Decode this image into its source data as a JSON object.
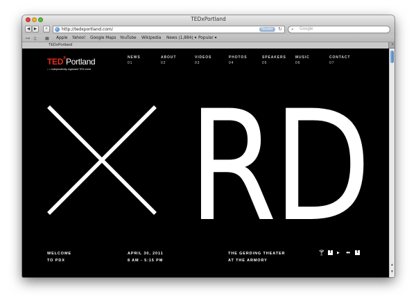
{
  "browser": {
    "window_title": "TEDxPortland",
    "url": "http://tedxportland.com/",
    "reader_label": "Reader",
    "search_placeholder": "Google",
    "nav_back": "◀",
    "nav_forward": "▶",
    "add_bookmark": "+",
    "bookmarks": [
      "Apple",
      "Yahoo!",
      "Google Maps",
      "YouTube",
      "Wikipedia",
      "News (1,884) ▾",
      "Popular ▾"
    ],
    "tab_title": "TEDxPortland"
  },
  "site": {
    "logo": {
      "ted": "TED",
      "x": "x",
      "city": "Portland",
      "tag_prefix": "x",
      "tag": " = independently organized TED event"
    },
    "nav": [
      {
        "label": "NEWS",
        "num": "01"
      },
      {
        "label": "ABOUT",
        "num": "02"
      },
      {
        "label": "VIDEOS",
        "num": "03"
      },
      {
        "label": "PHOTOS",
        "num": "04"
      },
      {
        "label": "SPEAKERS",
        "num": "05"
      },
      {
        "label": "MUSIC",
        "num": "06"
      },
      {
        "label": "CONTACT",
        "num": "07"
      }
    ],
    "hero_text": "RD",
    "footer": {
      "welcome_line1": "WELCOME",
      "welcome_line2": "TO PDX",
      "date_line1": "APRIL 30, 2011",
      "date_line2": "8 AM - 5:15 PM",
      "venue_line1": "THE GERDING THEATER",
      "venue_line2": "AT THE ARMORY"
    },
    "social_icons": [
      "martini-icon",
      "facebook-icon",
      "youtube-icon",
      "flickr-icon",
      "tumblr-icon"
    ],
    "colors": {
      "ted_red": "#e62b1e",
      "background": "#000000",
      "text": "#ffffff"
    }
  }
}
